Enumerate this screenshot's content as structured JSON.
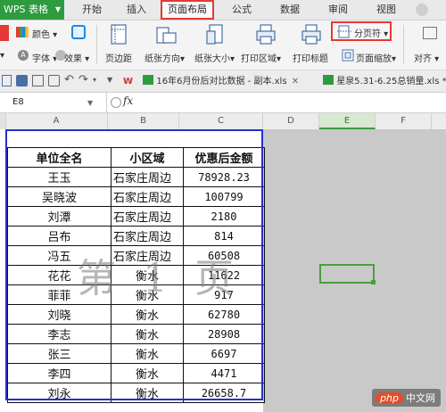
{
  "app": {
    "name": "WPS 表格"
  },
  "menu": [
    "开始",
    "插入",
    "页面布局",
    "公式",
    "数据",
    "审阅",
    "视图"
  ],
  "menu_active": "页面布局",
  "ribbon": {
    "color_label": "颜色",
    "font_label": "字体",
    "effect_label": "效果",
    "page_margin": "页边距",
    "orientation": "纸张方向",
    "paper_size": "纸张大小",
    "print_area": "打印区域",
    "print_title": "打印标题",
    "page_break": "分页符",
    "page_zoom": "页面缩放",
    "align": "对齐"
  },
  "doc_tabs": [
    "16年6月份后对比数据 - 副本.xls",
    "星泉5.31-6.25总销量.xls *"
  ],
  "formula_bar": {
    "cell": "E8",
    "fx": "fx"
  },
  "columns": [
    "A",
    "B",
    "C",
    "D",
    "E",
    "F"
  ],
  "table": {
    "headers": [
      "单位全名",
      "小区域",
      "优惠后金额"
    ],
    "rows": [
      [
        "王玉",
        "石家庄周边",
        "78928.23"
      ],
      [
        "吴晓波",
        "石家庄周边",
        "100799"
      ],
      [
        "刘潭",
        "石家庄周边",
        "2180"
      ],
      [
        "吕布",
        "石家庄周边",
        "814"
      ],
      [
        "冯五",
        "石家庄周边",
        "60508"
      ],
      [
        "花花",
        "衡水",
        "11622"
      ],
      [
        "菲菲",
        "衡水",
        "917"
      ],
      [
        "刘晓",
        "衡水",
        "62780"
      ],
      [
        "李志",
        "衡水",
        "28908"
      ],
      [
        "张三",
        "衡水",
        "6697"
      ],
      [
        "李四",
        "衡水",
        "4471"
      ],
      [
        "刘永",
        "衡水",
        "26658.7"
      ]
    ]
  },
  "watermark": "第 1 页",
  "logo": {
    "php": "php",
    "text": "中文网"
  }
}
